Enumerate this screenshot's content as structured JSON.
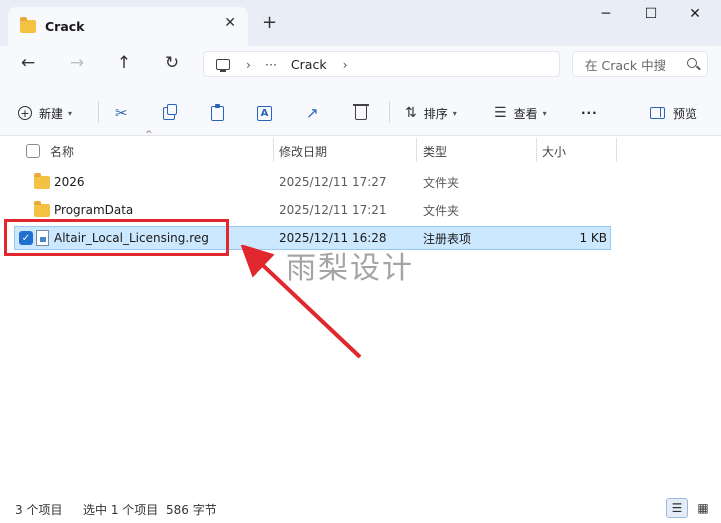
{
  "window": {
    "tab_title": "Crack",
    "tab_close": "✕",
    "new_tab": "+",
    "minimize": "─",
    "maximize": "☐",
    "close": "✕"
  },
  "nav": {
    "back": "←",
    "forward": "→",
    "up": "↑",
    "refresh": "↻"
  },
  "address": {
    "more": "···",
    "segment": "Crack",
    "separator": "›"
  },
  "search": {
    "placeholder": "在 Crack 中搜"
  },
  "toolbar": {
    "new_label": "新建",
    "sort_label": "排序",
    "view_label": "查看",
    "more": "···",
    "preview_label": "预览"
  },
  "columns": {
    "name": "名称",
    "modified": "修改日期",
    "type": "类型",
    "size": "大小"
  },
  "files": [
    {
      "name": "2026",
      "modified": "2025/12/11 17:27",
      "type": "文件夹",
      "size": "",
      "kind": "folder",
      "selected": false
    },
    {
      "name": "ProgramData",
      "modified": "2025/12/11 17:21",
      "type": "文件夹",
      "size": "",
      "kind": "folder",
      "selected": false
    },
    {
      "name": "Altair_Local_Licensing.reg",
      "modified": "2025/12/11 16:28",
      "type": "注册表项",
      "size": "1 KB",
      "kind": "reg",
      "selected": true
    }
  ],
  "watermark": "雨梨设计",
  "status": {
    "item_count": "3 个项目",
    "selected": "选中 1 个项目",
    "selected_size": "586 字节"
  },
  "colors": {
    "accent": "#1f6fd0",
    "selection_bg": "#cce8ff",
    "highlight_red": "#e0282e",
    "folder": "#f4c142"
  }
}
